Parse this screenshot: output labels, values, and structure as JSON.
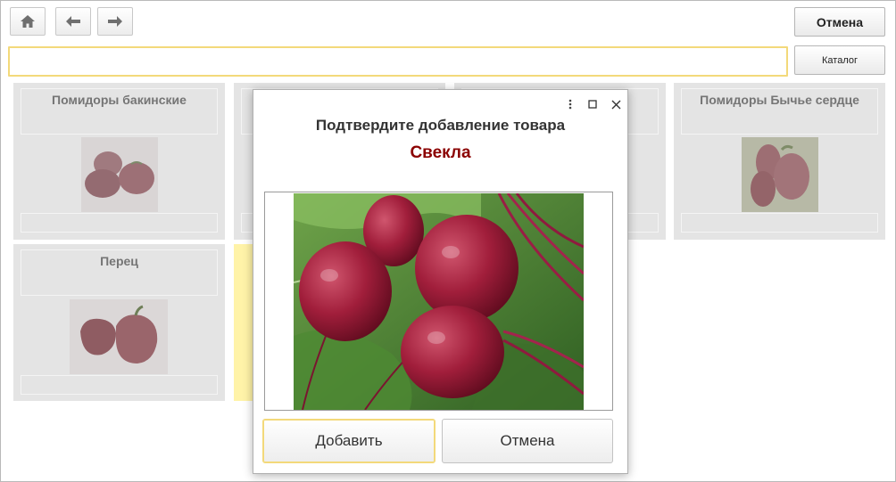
{
  "toolbar": {
    "home_icon": "home-icon",
    "back_icon": "arrow-left-icon",
    "forward_icon": "arrow-right-icon",
    "cancel_label": "Отмена",
    "catalog_label": "Каталог"
  },
  "search": {
    "value": "",
    "placeholder": ""
  },
  "tiles": [
    {
      "title": "Помидоры бакинские"
    },
    {
      "title": "Помидоры Бычье сердце"
    },
    {
      "title": "Перец"
    }
  ],
  "dialog": {
    "title": "Подтвердите добавление товара",
    "item_name": "Свекла",
    "menu_icon": "more-vertical-icon",
    "maximize_icon": "maximize-icon",
    "close_icon": "close-icon",
    "add_label": "Добавить",
    "cancel_label": "Отмена"
  },
  "colors": {
    "focus_border": "#f3d97a",
    "item_name": "#8b0000",
    "tile_bg": "#e4e4e4"
  }
}
